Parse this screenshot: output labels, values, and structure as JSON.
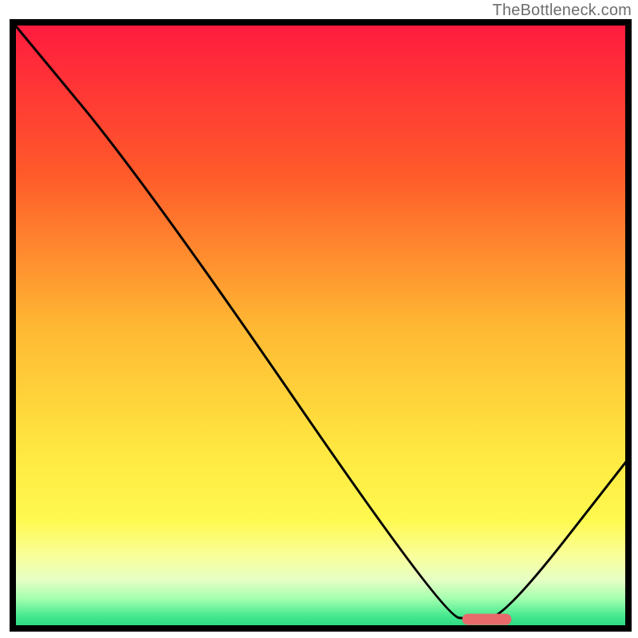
{
  "watermark": "TheBottleneck.com",
  "chart_data": {
    "type": "line",
    "title": "",
    "xlabel": "",
    "ylabel": "",
    "xlim": [
      0,
      100
    ],
    "ylim": [
      0,
      100
    ],
    "grid": false,
    "annotations": [],
    "line_points": [
      {
        "x": 0,
        "y": 100
      },
      {
        "x": 22,
        "y": 73
      },
      {
        "x": 70,
        "y": 2
      },
      {
        "x": 75,
        "y": 1.5
      },
      {
        "x": 80,
        "y": 2
      },
      {
        "x": 100,
        "y": 28
      }
    ],
    "marker": {
      "x_center": 77,
      "width": 8,
      "y": 1.5,
      "color": "#e86a6a"
    },
    "background_gradient": [
      {
        "offset": 0.0,
        "color": "#ff1a3f"
      },
      {
        "offset": 0.25,
        "color": "#ff5a2a"
      },
      {
        "offset": 0.5,
        "color": "#ffb733"
      },
      {
        "offset": 0.7,
        "color": "#ffe640"
      },
      {
        "offset": 0.82,
        "color": "#fff94f"
      },
      {
        "offset": 0.88,
        "color": "#f9ff9a"
      },
      {
        "offset": 0.92,
        "color": "#e6ffc4"
      },
      {
        "offset": 0.95,
        "color": "#a6ffb0"
      },
      {
        "offset": 0.98,
        "color": "#44e98f"
      },
      {
        "offset": 1.0,
        "color": "#26d47f"
      }
    ],
    "border_color": "#000000"
  }
}
